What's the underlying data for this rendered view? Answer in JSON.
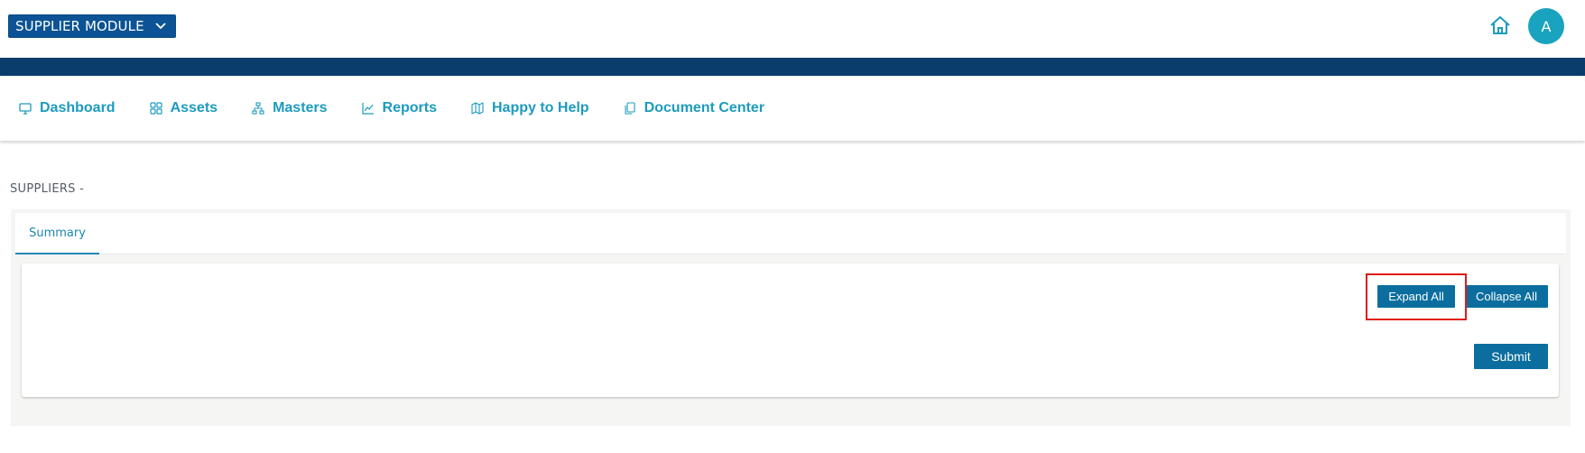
{
  "header": {
    "module_label": "SUPPLIER MODULE",
    "avatar_initial": "A"
  },
  "nav": {
    "items": [
      {
        "label": "Dashboard",
        "icon": "monitor-icon"
      },
      {
        "label": "Assets",
        "icon": "grid-icon"
      },
      {
        "label": "Masters",
        "icon": "sitemap-icon"
      },
      {
        "label": "Reports",
        "icon": "chart-line-icon"
      },
      {
        "label": "Happy to Help",
        "icon": "map-icon"
      },
      {
        "label": "Document Center",
        "icon": "documents-icon"
      }
    ]
  },
  "page": {
    "breadcrumb": "SUPPLIERS -",
    "tabs": [
      {
        "label": "Summary",
        "active": true
      }
    ],
    "buttons": {
      "expand_all": "Expand All",
      "collapse_all": "Collapse All",
      "submit": "Submit"
    }
  },
  "colors": {
    "brand_dark": "#0a3d6b",
    "module_select": "#0b5394",
    "nav_text": "#1c9bbd",
    "button": "#0b6e9e",
    "avatar": "#19a3bf",
    "highlight": "#e01b1b"
  }
}
